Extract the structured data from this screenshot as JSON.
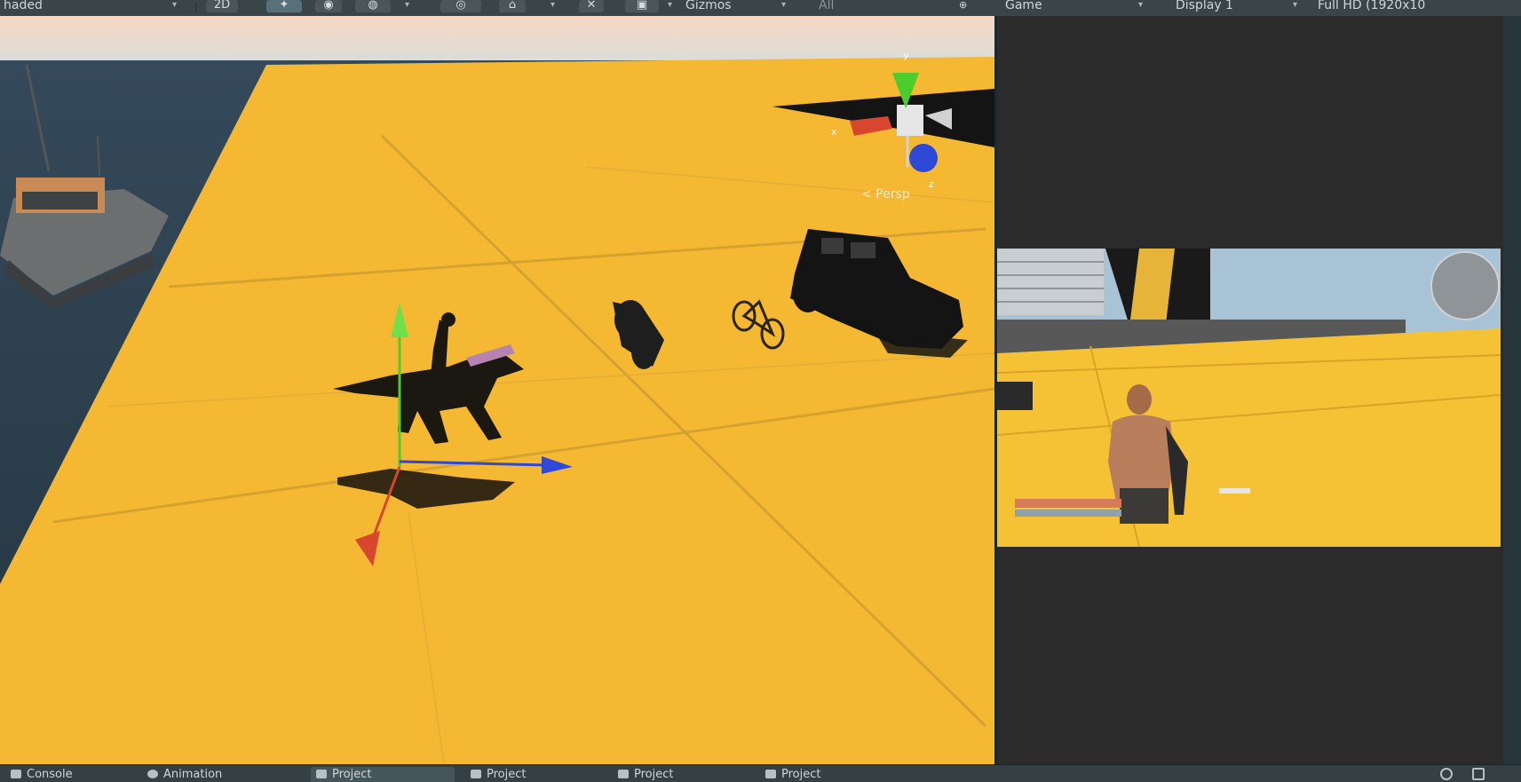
{
  "toolbar": {
    "shading_mode": "haded",
    "mode_2d": "2D",
    "fx_label": "ⓘ",
    "audio_label": "◉",
    "gizmos_label": "Gizmos",
    "search_placeholder": "All",
    "game_tab": "Game",
    "display": "Display 1",
    "resolution": "Full HD (1920x10"
  },
  "scene": {
    "persp_label": "< Persp"
  },
  "bottom_tabs": [
    {
      "label": "Console",
      "icon": "console-icon"
    },
    {
      "label": "Animation",
      "icon": "clock-icon"
    },
    {
      "label": "Project",
      "icon": "folder-icon",
      "active": true
    },
    {
      "label": "Project",
      "icon": "folder-icon"
    },
    {
      "label": "Project",
      "icon": "folder-icon"
    },
    {
      "label": "Project",
      "icon": "folder-icon"
    }
  ],
  "colors": {
    "ground": "#f4b833",
    "water": "#2e3e4a",
    "axis_x": "#d9462e",
    "axis_y": "#4ccd2d",
    "axis_z": "#2e49d6",
    "panel_bg": "#2b2b2b"
  }
}
